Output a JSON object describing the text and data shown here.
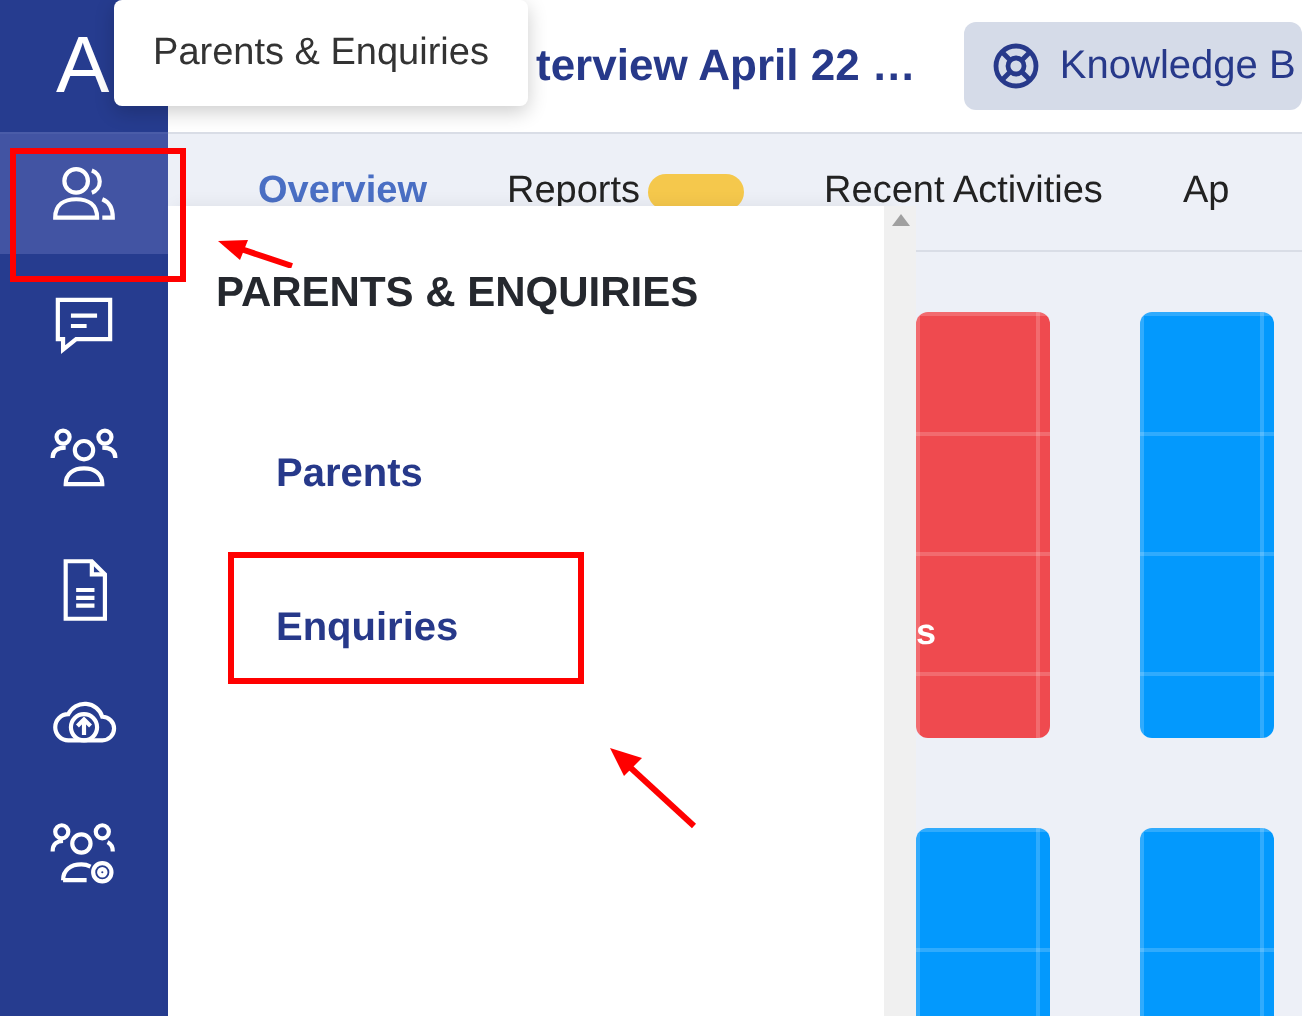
{
  "logo": "A",
  "tooltip": "Parents & Enquiries",
  "header": {
    "title": "terview April 22 …",
    "help_button": "Knowledge B"
  },
  "sidebar": {
    "items": [
      {
        "selected": true
      },
      {
        "selected": false
      },
      {
        "selected": false
      },
      {
        "selected": false
      },
      {
        "selected": false
      },
      {
        "selected": false
      }
    ]
  },
  "tabs": [
    {
      "label": "Overview",
      "selected": true,
      "badge": false
    },
    {
      "label": "Reports",
      "selected": false,
      "badge": true
    },
    {
      "label": "Recent Activities",
      "selected": false,
      "badge": false
    },
    {
      "label": "Ap",
      "selected": false,
      "badge": false
    }
  ],
  "cards": [
    {
      "color": "#ef4a4f",
      "label": "s"
    },
    {
      "color": "#0399fd"
    },
    {
      "color": "#0399fd"
    },
    {
      "color": "#0399fd"
    }
  ],
  "menu": {
    "title": "PARENTS & ENQUIRIES",
    "items": [
      {
        "label": "Parents",
        "highlighted": false
      },
      {
        "label": "Enquiries",
        "highlighted": true
      }
    ]
  },
  "annotations": {
    "sidebar_highlight": true
  }
}
